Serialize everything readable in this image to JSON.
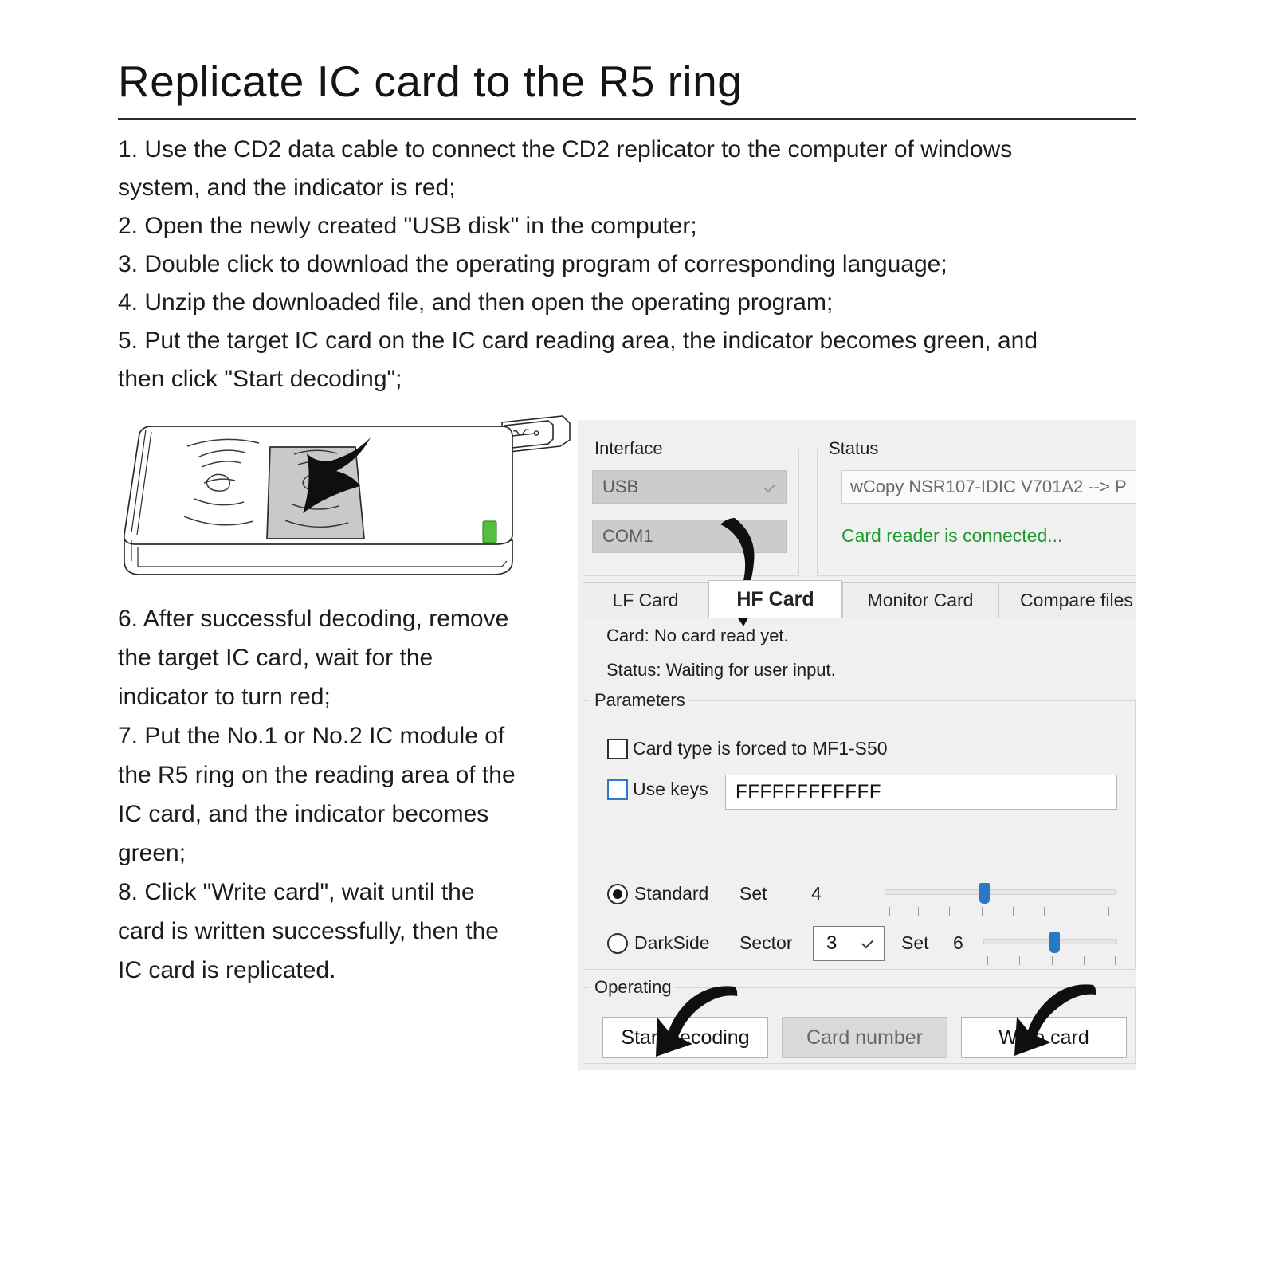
{
  "document": {
    "title": "Replicate IC card to the R5 ring",
    "steps_top": [
      "1. Use the CD2 data cable to connect the CD2 replicator to the computer of windows",
      "system, and the indicator is red;",
      "2. Open the newly created \"USB disk\" in the computer;",
      "3. Double click to download the operating program of corresponding language;",
      "4. Unzip the downloaded file, and then open the operating program;",
      "5. Put the target IC card on the IC card reading area, the indicator becomes green, and",
      "then click \"Start decoding\";"
    ],
    "steps_bottom": [
      "6. After successful decoding, remove",
      "the target IC card, wait for the",
      "indicator to turn red;",
      "7. Put the No.1 or No.2 IC module of",
      "the R5 ring on the reading area of the",
      "IC card, and the indicator becomes",
      "green;",
      "8. Click \"Write card\", wait until the",
      "card is written successfully, then the",
      "IC card is replicated."
    ]
  },
  "illustration": {
    "name": "cd2-replicator-device",
    "indicator_color": "#57bf3f",
    "card_fill": "#c9c9c9"
  },
  "app": {
    "interface": {
      "group_label": "Interface",
      "connection_value": "USB",
      "port_value": "COM1"
    },
    "status": {
      "group_label": "Status",
      "device_value": "wCopy NSR107-IDIC V701A2 --> P",
      "message": "Card reader is connected...",
      "message_color": "#1f9b2e"
    },
    "tabs": [
      {
        "label": "LF Card",
        "active": false
      },
      {
        "label": "HF Card",
        "active": true
      },
      {
        "label": "Monitor Card",
        "active": false
      },
      {
        "label": "Compare files",
        "active": false
      }
    ],
    "info": {
      "card_line": "Card: No card read yet.",
      "status_line": "Status: Waiting for user input."
    },
    "parameters": {
      "group_label": "Parameters",
      "force_type_label": "Card type is forced to MF1-S50",
      "force_type_checked": false,
      "use_keys_label": "Use keys",
      "use_keys_checked": false,
      "keys_value": "FFFFFFFFFFFF",
      "standard_label": "Standard",
      "standard_selected": true,
      "standard_set_label": "Set",
      "standard_set_value": "4",
      "standard_slider": {
        "value": 4,
        "min": 1,
        "max": 8,
        "ticks": 8
      },
      "darkside_label": "DarkSide",
      "darkside_selected": false,
      "darkside_sector_label": "Sector",
      "darkside_sector_value": "3",
      "darkside_set_label": "Set",
      "darkside_set_value": "6",
      "darkside_slider": {
        "value": 6,
        "min": 1,
        "max": 10,
        "ticks": 5
      }
    },
    "operating": {
      "group_label": "Operating",
      "buttons": [
        {
          "label": "Start decoding",
          "state": "enabled"
        },
        {
          "label": "Card number",
          "state": "disabled"
        },
        {
          "label": "Write card",
          "state": "enabled"
        }
      ]
    },
    "colors": {
      "panel_bg": "#f0f0f0",
      "combo_bg": "#cccccc",
      "accent_blue": "#2a79c5",
      "status_green": "#1f9b2e"
    }
  },
  "annotations": [
    {
      "name": "arrow-to-card-reading-area"
    },
    {
      "name": "arrow-to-hf-card-tab"
    },
    {
      "name": "arrow-to-start-decoding"
    },
    {
      "name": "arrow-to-write-card"
    }
  ]
}
